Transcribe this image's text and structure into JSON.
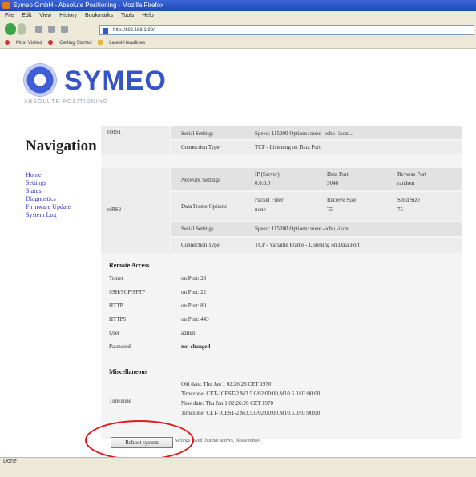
{
  "browser": {
    "title": "Symeo GmbH - Absolute Positioning - Mozilla Firefox",
    "menu": [
      "File",
      "Edit",
      "View",
      "History",
      "Bookmarks",
      "Tools",
      "Help"
    ],
    "url": "http://192.168.1.99/",
    "bookmarks": [
      "Most Visited",
      "Getting Started",
      "Latest Headlines"
    ],
    "status": "Done"
  },
  "brand": {
    "name": "SYMEO",
    "tagline": "ABSOLUTE POSITIONING"
  },
  "nav": {
    "title": "Navigation",
    "links": [
      "Home",
      "Settings",
      "Status",
      "Diagnostics",
      "Firmware Update",
      "System Log"
    ]
  },
  "table": {
    "rs485": {
      "name": "rsRS1",
      "serial_label": "Serial Settings",
      "serial_value": "Speed: 115200 Options: none -echo -ixon...",
      "conn_label": "Connection Type",
      "conn_value": "TCP - Listening on Data Port"
    },
    "rs232": {
      "name": "rsRS2",
      "network_label": "Network Settings",
      "ip_head": "IP (Server)",
      "ip_val": "0.0.0.0",
      "port_head": "Data Port",
      "port_val": "3046",
      "rport_head": "Reverse Port",
      "rport_val": "random",
      "frame_label": "Data Frame Options",
      "pfilter_head": "Packet Filter",
      "pfilter_val": "none",
      "rsize_head": "Receive Size",
      "rsize_val": "75",
      "ssize_head": "Send Size",
      "ssize_val": "75",
      "serial_label": "Serial Settings",
      "serial_value": "Speed: 115200 Options: none -echo -ixon...",
      "conn_label": "Connection Type",
      "conn_value": "TCP - Variable Frame - Listening on Data Port"
    }
  },
  "remote": {
    "title": "Remote Access",
    "items": [
      {
        "label": "Telnet",
        "value": "on Port: 23"
      },
      {
        "label": "SSH/SCP/SFTP",
        "value": "on Port: 22"
      },
      {
        "label": "HTTP",
        "value": "on Port: 80"
      },
      {
        "label": "HTTPS",
        "value": "on Port: 443"
      },
      {
        "label": "User",
        "value": "admin"
      },
      {
        "label": "Password",
        "value": "not changed"
      }
    ]
  },
  "misc": {
    "title": "Miscellaneous",
    "timezone_label": "Timezone",
    "lines": [
      "Old date: Thu Jan 1 02:26:26 CET 1970",
      "Timezone: CET-1CEST-2,M3.5.0/02:00:00,M10.5.0/03:00:00",
      "New date: Thu Jan 1 02:26:26 CET 1970",
      "Timezone: CET-1CEST-2,M3.5.0/02:00:00,M10.5.0/03:00:00"
    ]
  },
  "action": {
    "button_label": "Reboot system",
    "note": "Settings saved (but not active), please reboot"
  },
  "colors": {
    "highlight_ellipse": "#e0181a",
    "brand_blue": "#3554c8",
    "link_blue": "#2a34c0"
  }
}
